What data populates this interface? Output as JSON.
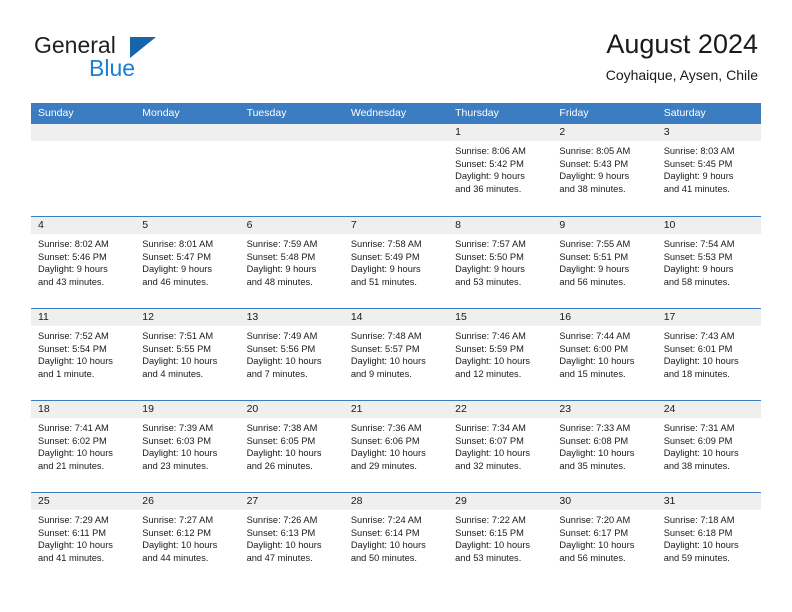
{
  "brand": {
    "name_part1": "General",
    "name_part2": "Blue",
    "accent_color": "#1664ac",
    "blue_text_color": "#1b7fd4"
  },
  "header": {
    "title": "August 2024",
    "subtitle": "Coyhaique, Aysen, Chile"
  },
  "theme": {
    "header_row_bg": "#3b7dc0",
    "daynum_band_bg": "#efefef",
    "week_separator": "#3b7dc0",
    "text_color": "#1a1a1a"
  },
  "weekday_headers": [
    "Sunday",
    "Monday",
    "Tuesday",
    "Wednesday",
    "Thursday",
    "Friday",
    "Saturday"
  ],
  "weeks": [
    [
      {
        "day": "",
        "lines": []
      },
      {
        "day": "",
        "lines": []
      },
      {
        "day": "",
        "lines": []
      },
      {
        "day": "",
        "lines": []
      },
      {
        "day": "1",
        "lines": [
          "Sunrise: 8:06 AM",
          "Sunset: 5:42 PM",
          "Daylight: 9 hours",
          "and 36 minutes."
        ]
      },
      {
        "day": "2",
        "lines": [
          "Sunrise: 8:05 AM",
          "Sunset: 5:43 PM",
          "Daylight: 9 hours",
          "and 38 minutes."
        ]
      },
      {
        "day": "3",
        "lines": [
          "Sunrise: 8:03 AM",
          "Sunset: 5:45 PM",
          "Daylight: 9 hours",
          "and 41 minutes."
        ]
      }
    ],
    [
      {
        "day": "4",
        "lines": [
          "Sunrise: 8:02 AM",
          "Sunset: 5:46 PM",
          "Daylight: 9 hours",
          "and 43 minutes."
        ]
      },
      {
        "day": "5",
        "lines": [
          "Sunrise: 8:01 AM",
          "Sunset: 5:47 PM",
          "Daylight: 9 hours",
          "and 46 minutes."
        ]
      },
      {
        "day": "6",
        "lines": [
          "Sunrise: 7:59 AM",
          "Sunset: 5:48 PM",
          "Daylight: 9 hours",
          "and 48 minutes."
        ]
      },
      {
        "day": "7",
        "lines": [
          "Sunrise: 7:58 AM",
          "Sunset: 5:49 PM",
          "Daylight: 9 hours",
          "and 51 minutes."
        ]
      },
      {
        "day": "8",
        "lines": [
          "Sunrise: 7:57 AM",
          "Sunset: 5:50 PM",
          "Daylight: 9 hours",
          "and 53 minutes."
        ]
      },
      {
        "day": "9",
        "lines": [
          "Sunrise: 7:55 AM",
          "Sunset: 5:51 PM",
          "Daylight: 9 hours",
          "and 56 minutes."
        ]
      },
      {
        "day": "10",
        "lines": [
          "Sunrise: 7:54 AM",
          "Sunset: 5:53 PM",
          "Daylight: 9 hours",
          "and 58 minutes."
        ]
      }
    ],
    [
      {
        "day": "11",
        "lines": [
          "Sunrise: 7:52 AM",
          "Sunset: 5:54 PM",
          "Daylight: 10 hours",
          "and 1 minute."
        ]
      },
      {
        "day": "12",
        "lines": [
          "Sunrise: 7:51 AM",
          "Sunset: 5:55 PM",
          "Daylight: 10 hours",
          "and 4 minutes."
        ]
      },
      {
        "day": "13",
        "lines": [
          "Sunrise: 7:49 AM",
          "Sunset: 5:56 PM",
          "Daylight: 10 hours",
          "and 7 minutes."
        ]
      },
      {
        "day": "14",
        "lines": [
          "Sunrise: 7:48 AM",
          "Sunset: 5:57 PM",
          "Daylight: 10 hours",
          "and 9 minutes."
        ]
      },
      {
        "day": "15",
        "lines": [
          "Sunrise: 7:46 AM",
          "Sunset: 5:59 PM",
          "Daylight: 10 hours",
          "and 12 minutes."
        ]
      },
      {
        "day": "16",
        "lines": [
          "Sunrise: 7:44 AM",
          "Sunset: 6:00 PM",
          "Daylight: 10 hours",
          "and 15 minutes."
        ]
      },
      {
        "day": "17",
        "lines": [
          "Sunrise: 7:43 AM",
          "Sunset: 6:01 PM",
          "Daylight: 10 hours",
          "and 18 minutes."
        ]
      }
    ],
    [
      {
        "day": "18",
        "lines": [
          "Sunrise: 7:41 AM",
          "Sunset: 6:02 PM",
          "Daylight: 10 hours",
          "and 21 minutes."
        ]
      },
      {
        "day": "19",
        "lines": [
          "Sunrise: 7:39 AM",
          "Sunset: 6:03 PM",
          "Daylight: 10 hours",
          "and 23 minutes."
        ]
      },
      {
        "day": "20",
        "lines": [
          "Sunrise: 7:38 AM",
          "Sunset: 6:05 PM",
          "Daylight: 10 hours",
          "and 26 minutes."
        ]
      },
      {
        "day": "21",
        "lines": [
          "Sunrise: 7:36 AM",
          "Sunset: 6:06 PM",
          "Daylight: 10 hours",
          "and 29 minutes."
        ]
      },
      {
        "day": "22",
        "lines": [
          "Sunrise: 7:34 AM",
          "Sunset: 6:07 PM",
          "Daylight: 10 hours",
          "and 32 minutes."
        ]
      },
      {
        "day": "23",
        "lines": [
          "Sunrise: 7:33 AM",
          "Sunset: 6:08 PM",
          "Daylight: 10 hours",
          "and 35 minutes."
        ]
      },
      {
        "day": "24",
        "lines": [
          "Sunrise: 7:31 AM",
          "Sunset: 6:09 PM",
          "Daylight: 10 hours",
          "and 38 minutes."
        ]
      }
    ],
    [
      {
        "day": "25",
        "lines": [
          "Sunrise: 7:29 AM",
          "Sunset: 6:11 PM",
          "Daylight: 10 hours",
          "and 41 minutes."
        ]
      },
      {
        "day": "26",
        "lines": [
          "Sunrise: 7:27 AM",
          "Sunset: 6:12 PM",
          "Daylight: 10 hours",
          "and 44 minutes."
        ]
      },
      {
        "day": "27",
        "lines": [
          "Sunrise: 7:26 AM",
          "Sunset: 6:13 PM",
          "Daylight: 10 hours",
          "and 47 minutes."
        ]
      },
      {
        "day": "28",
        "lines": [
          "Sunrise: 7:24 AM",
          "Sunset: 6:14 PM",
          "Daylight: 10 hours",
          "and 50 minutes."
        ]
      },
      {
        "day": "29",
        "lines": [
          "Sunrise: 7:22 AM",
          "Sunset: 6:15 PM",
          "Daylight: 10 hours",
          "and 53 minutes."
        ]
      },
      {
        "day": "30",
        "lines": [
          "Sunrise: 7:20 AM",
          "Sunset: 6:17 PM",
          "Daylight: 10 hours",
          "and 56 minutes."
        ]
      },
      {
        "day": "31",
        "lines": [
          "Sunrise: 7:18 AM",
          "Sunset: 6:18 PM",
          "Daylight: 10 hours",
          "and 59 minutes."
        ]
      }
    ]
  ]
}
